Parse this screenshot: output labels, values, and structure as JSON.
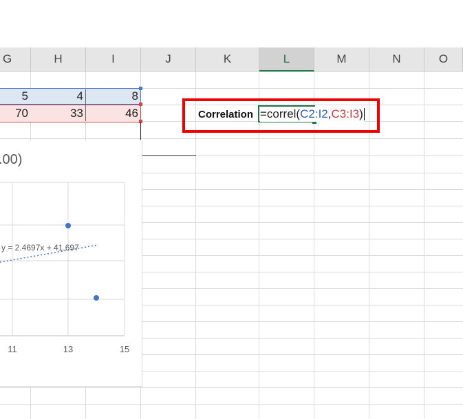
{
  "columns": [
    "G",
    "H",
    "I",
    "J",
    "K",
    "L",
    "M",
    "N",
    "O"
  ],
  "selected_column": "L",
  "row2": [
    "5",
    "4",
    "8"
  ],
  "row3": [
    "70",
    "33",
    "46"
  ],
  "label_cell": "Correlation",
  "formula": {
    "prefix": "=correl(",
    "range1": "C2:I2",
    "sep": ", ",
    "range2": "C3:I3",
    "suffix": ")"
  },
  "chart": {
    "title_fragment": ".00)",
    "trendline_label": "y = 2.4697x + 41.697",
    "x_ticks": [
      "11",
      "13",
      "15"
    ]
  },
  "chart_data": {
    "type": "scatter",
    "title": ".00)",
    "x_ticks": [
      "11",
      "13",
      "15"
    ],
    "points": [
      {
        "x": 13,
        "y": null
      },
      {
        "x": 14,
        "y": null
      }
    ],
    "trendline": "y = 2.4697x + 41.697",
    "grid": true
  },
  "colors": {
    "range1": "#2f5fb5",
    "range2": "#c43c3c",
    "accent": "#217346",
    "highlight": "#ee0000",
    "point": "#4472c4"
  }
}
